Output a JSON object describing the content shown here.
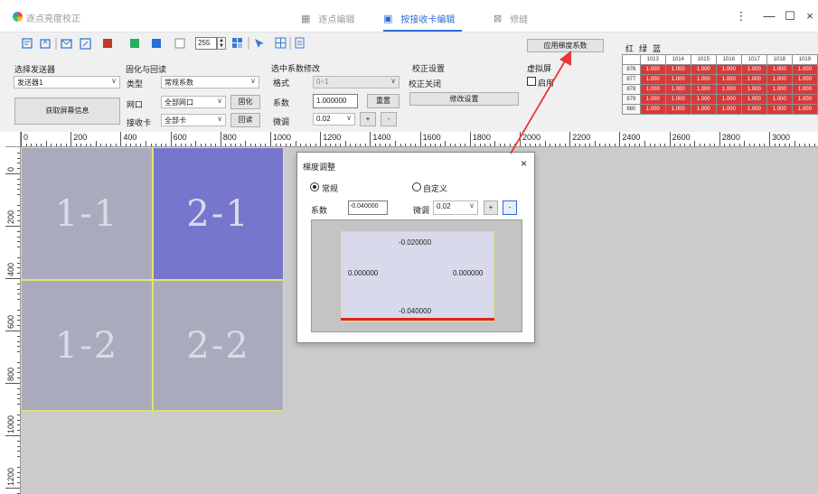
{
  "app": {
    "title": "逐点亮度校正"
  },
  "tabs": [
    {
      "label": "逐点编辑",
      "icon": "grid-icon",
      "active": false
    },
    {
      "label": "按接收卡编辑",
      "icon": "card-icon",
      "active": true
    },
    {
      "label": "修缝",
      "icon": "seam-icon",
      "active": false
    }
  ],
  "window": {
    "more": "⋮",
    "minimize": "—",
    "maximize": "☐",
    "close": "×"
  },
  "toolbar": {
    "brightness_value": "255",
    "apply_button": "应用梯度系数",
    "rgb": [
      "红",
      "绿",
      "蓝"
    ]
  },
  "sender": {
    "label": "选择发送器",
    "value": "发送器1",
    "get_info": "获取屏幕信息"
  },
  "solidify": {
    "label": "固化与回读",
    "type_label": "类型",
    "type_value": "常规系数",
    "port_label": "网口",
    "port_value": "全部网口",
    "solidify_btn": "固化",
    "card_label": "接收卡",
    "card_value": "全部卡",
    "readback_btn": "回读"
  },
  "coef_edit": {
    "label": "选中系数修改",
    "format_label": "格式",
    "format_value": "0~1",
    "coef_label": "系数",
    "coef_value": "1.000000",
    "reset_btn": "重置",
    "fine_label": "微调",
    "fine_value": "0.02",
    "plus": "+",
    "minus": "-"
  },
  "calib": {
    "label": "校正设置",
    "status": "校正关闭",
    "modify_btn": "修改设置"
  },
  "virtual": {
    "label": "虚拟屏",
    "enable": "启用"
  },
  "grid": {
    "cols": [
      "1013",
      "1014",
      "1015",
      "1016",
      "1017",
      "1018",
      "1019"
    ],
    "rows": [
      "876",
      "877",
      "878",
      "879",
      "880"
    ],
    "value": "1.000"
  },
  "ruler": {
    "top": [
      "0",
      "200",
      "400",
      "600",
      "800",
      "1000",
      "1200",
      "1400",
      "1600",
      "1800",
      "2000",
      "2200",
      "2400",
      "2600",
      "2800",
      "3000"
    ],
    "left": [
      "0",
      "200",
      "400",
      "600",
      "800",
      "1000",
      "1200"
    ]
  },
  "tiles": [
    {
      "label": "1-1",
      "color": "#a9abbd"
    },
    {
      "label": "2-1",
      "color": "#7677cc"
    },
    {
      "label": "1-2",
      "color": "#a9abbd"
    },
    {
      "label": "2-2",
      "color": "#a9abbd"
    }
  ],
  "dialog": {
    "title": "梯度调整",
    "close": "×",
    "mode_normal": "常规",
    "mode_custom": "自定义",
    "coef_label": "系数",
    "coef_value": "-0.040000",
    "fine_label": "微调",
    "fine_value": "0.02",
    "plus": "+",
    "minus": "-",
    "preview": {
      "top": "-0.020000",
      "left": "0.000000",
      "right": "0.000000",
      "bottom": "-0.040000"
    }
  },
  "colors": {
    "accent": "#2b6cd6",
    "cell_red": "#d83a3a",
    "arrow_red": "#e53935"
  }
}
